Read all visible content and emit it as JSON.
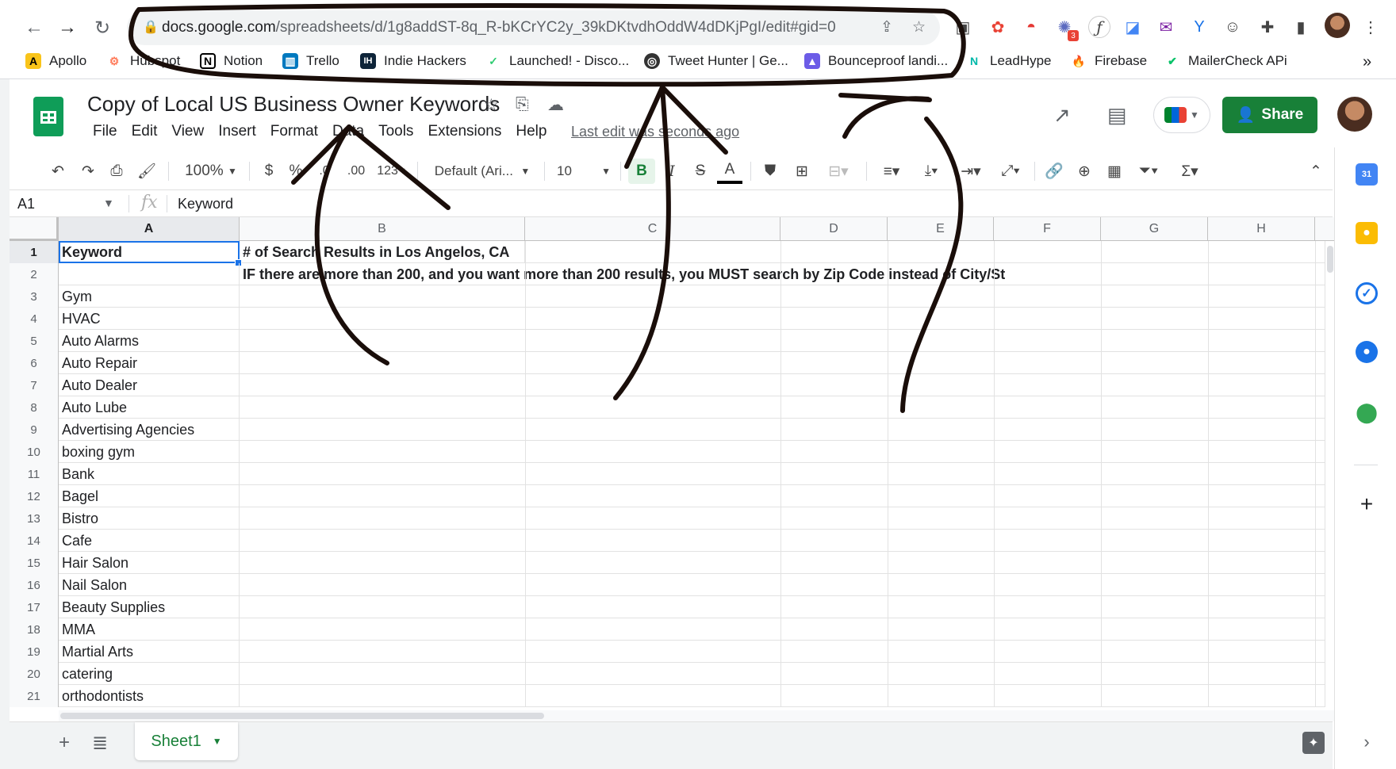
{
  "browser": {
    "url_host": "docs.google.com",
    "url_path": "/spreadsheets/d/1g8addST-8q_R-bKCrYC2y_39kDKtvdhOddW4dDKjPgI/edit#gid=0",
    "extension_badge": "3",
    "bookmarks": [
      {
        "label": "Apollo",
        "color": "#f9c41a",
        "icon": "apollo-icon"
      },
      {
        "label": "Hubspot",
        "color": "#ff7a59",
        "icon": "hubspot-icon"
      },
      {
        "label": "Notion",
        "color": "#000000",
        "icon": "notion-icon"
      },
      {
        "label": "Trello",
        "color": "#0079bf",
        "icon": "trello-icon"
      },
      {
        "label": "Indie Hackers",
        "color": "#0e2439",
        "icon": "indie-hackers-icon"
      },
      {
        "label": "Launched! - Disco...",
        "color": "#2ecc71",
        "icon": "launched-icon"
      },
      {
        "label": "Tweet Hunter | Ge...",
        "color": "#333333",
        "icon": "tweet-hunter-icon"
      },
      {
        "label": "Bounceproof landi...",
        "color": "#6c5ce7",
        "icon": "bounceproof-icon"
      },
      {
        "label": "LeadHype",
        "color": "#00b8a9",
        "icon": "leadhype-icon"
      },
      {
        "label": "Firebase",
        "color": "#ffa000",
        "icon": "firebase-icon"
      },
      {
        "label": "MailerCheck APi",
        "color": "#09c269",
        "icon": "mailercheck-icon"
      }
    ],
    "overflow": "»"
  },
  "doc": {
    "title": "Copy of Local US Business Owner Keywords",
    "last_edit": "Last edit was seconds ago",
    "share_label": "Share"
  },
  "menu": [
    "File",
    "Edit",
    "View",
    "Insert",
    "Format",
    "Data",
    "Tools",
    "Extensions",
    "Help"
  ],
  "toolbar": {
    "zoom": "100%",
    "currency": "$",
    "percent": "%",
    "dec_less": ".0",
    "dec_more": ".00",
    "more_formats": "123",
    "font": "Default (Ari...",
    "font_size": "10"
  },
  "formula_bar": {
    "cell_ref": "A1",
    "fx": "fx",
    "value": "Keyword"
  },
  "columns": [
    "A",
    "B",
    "C",
    "D",
    "E",
    "F",
    "G",
    "H"
  ],
  "rows": [
    {
      "n": "1",
      "a": "Keyword",
      "b": "# of Search Results in Los Angelos, CA",
      "bold": true
    },
    {
      "n": "2",
      "a": "",
      "b": "IF there are more than 200, and you want more than 200 results, you MUST search by Zip Code instead of City/St",
      "bold": true
    },
    {
      "n": "3",
      "a": "Gym",
      "b": ""
    },
    {
      "n": "4",
      "a": "HVAC",
      "b": ""
    },
    {
      "n": "5",
      "a": "Auto Alarms",
      "b": ""
    },
    {
      "n": "6",
      "a": "Auto Repair",
      "b": ""
    },
    {
      "n": "7",
      "a": "Auto Dealer",
      "b": ""
    },
    {
      "n": "8",
      "a": "Auto Lube",
      "b": ""
    },
    {
      "n": "9",
      "a": "Advertising Agencies",
      "b": ""
    },
    {
      "n": "10",
      "a": "boxing gym",
      "b": ""
    },
    {
      "n": "11",
      "a": "Bank",
      "b": ""
    },
    {
      "n": "12",
      "a": "Bagel",
      "b": ""
    },
    {
      "n": "13",
      "a": "Bistro",
      "b": ""
    },
    {
      "n": "14",
      "a": "Cafe",
      "b": ""
    },
    {
      "n": "15",
      "a": "Hair Salon",
      "b": ""
    },
    {
      "n": "16",
      "a": "Nail Salon",
      "b": ""
    },
    {
      "n": "17",
      "a": "Beauty Supplies",
      "b": ""
    },
    {
      "n": "18",
      "a": "MMA",
      "b": ""
    },
    {
      "n": "19",
      "a": "Martial Arts",
      "b": ""
    },
    {
      "n": "20",
      "a": "catering",
      "b": ""
    },
    {
      "n": "21",
      "a": "orthodontists",
      "b": ""
    }
  ],
  "sheet_tab": "Sheet1",
  "colors": {
    "sheets_green": "#0f9d58",
    "share_green": "#188038",
    "selection_blue": "#1a73e8",
    "annotation_ink": "#1a0e0a"
  }
}
